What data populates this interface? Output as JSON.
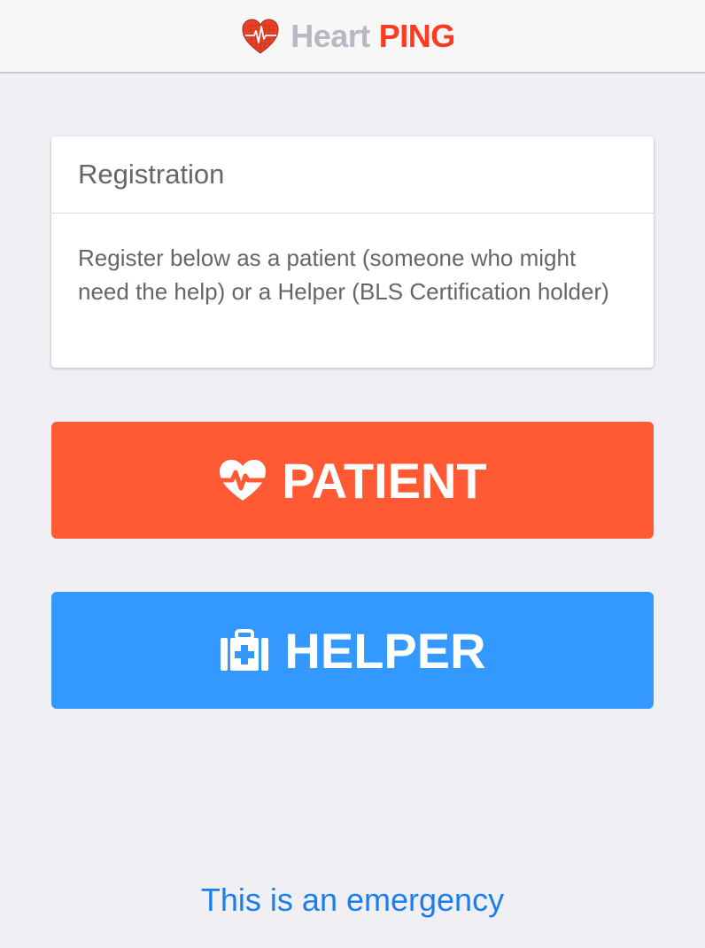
{
  "header": {
    "brand_heart": "Heart",
    "brand_ping": "PING",
    "logo_icon": "heart-ecg-icon"
  },
  "registration_card": {
    "title": "Registration",
    "description": "Register below as a patient (someone who might need the help) or a Helper (BLS Certification holder)"
  },
  "buttons": {
    "patient_label": "PATIENT",
    "patient_icon": "heartbeat-icon",
    "helper_label": "HELPER",
    "helper_icon": "medkit-icon"
  },
  "footer": {
    "emergency_link": "This is an emergency"
  },
  "colors": {
    "background": "#efeff4",
    "brand_red": "#ff3b1f",
    "patient_orange": "#ff5a33",
    "helper_blue": "#3399ff",
    "link_blue": "#1a7ef0"
  }
}
